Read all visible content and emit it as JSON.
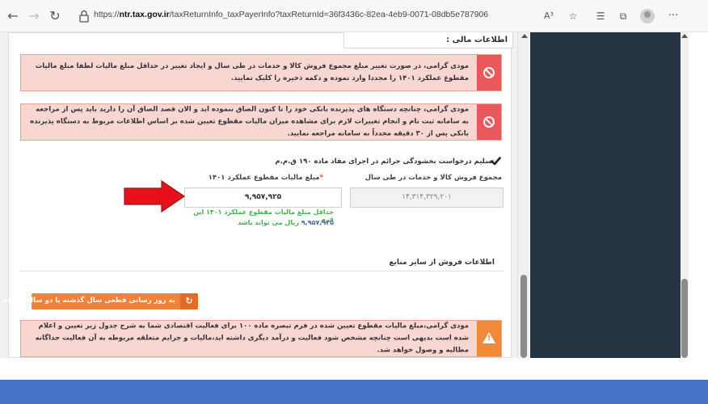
{
  "browser": {
    "url_prefix": "https://",
    "url_host": "ntr.tax.gov.ir",
    "url_path": "/taxReturnInfo_taxPayerInfo?taxReturnId=36f3436c-82ea-4eb9-0071-08db5e787906",
    "icons": [
      "back-icon",
      "forward-icon",
      "refresh-icon",
      "lock-icon",
      "read-aloud-icon",
      "favorite-icon",
      "favorites-list-icon",
      "collections-icon",
      "profile-icon",
      "more-icon"
    ],
    "read_aloud_label": "A³",
    "more_label": "···"
  },
  "panel": {
    "title": "اطلاعات مالی :"
  },
  "alerts": [
    {
      "type": "danger",
      "text": "مودی گرامی، در صورت تغییر مبلغ مجموع فروش کالا و خدمات در طی سال و ایجاد تغییر در حداقل مبلغ مالیات لطفا مبلغ مالیات مقطوع عملکرد ۱۴۰۱ را مجددا وارد نموده و دکمه ذخیره را کلیک نمایید."
    },
    {
      "type": "danger",
      "text": "مودی گرامی، چنانچه دستگاه های پذیرنده بانکی خود را تا کنون الصاق ننموده اید و الان قصد الصاق آن را دارید باید پس از مراجعه به سامانه ثبت نام و انجام تغییرات لازم برای مشاهده میزان مالیات مقطوع تعیین شده بر اساس اطلاعات مربوط به دستگاه پذیرنده بانکی پس از ۳۰ دقیقه مجدداً به سامانه مراجعه نمایید."
    }
  ],
  "checkbox": {
    "label": "تسلیم درخواست بخشودگی جرائم در اجرای مفاد ماده ۱۹۰ ق.م.م",
    "checked": true
  },
  "fields": {
    "sales_label": "مجموع فروش کالا و خدمات در طی سال",
    "sales_value": "۱۴,۳۱۴,۳۲۹,۲۰۱",
    "tax_label": "مبلغ مالیات مقطوع عملکرد ۱۴۰۱",
    "tax_required_mark": "*",
    "tax_value": "۹,۹۵۷,۹۲۵"
  },
  "hint": {
    "line1": "حداقل مبلغ مالیات مقطوع عملکرد ۱۴۰۱ این فرم",
    "amount": "۹,۹۵۷,۹۲۵",
    "line2_suffix": "ریال می تواند باشد"
  },
  "other_sales": {
    "title": "اطلاعات فروش از سایر منابع"
  },
  "update_button": {
    "label": "به روز رسانی قطعی سال گذشته یا دو سال گذشته"
  },
  "warning": {
    "type": "warning",
    "text": "مودی گرامی،مبلغ مالیات مقطوع تعیین شده در فرم تبصره ماده ۱۰۰ برای فعالیت اقتصادی شما به شرح جدول زیر تعیین و اعلام شده است بدیهی است چنانچه مشخص شود فعالیت و درآمد دیگری داشته اید،مالیات و جرایم متعلقه مربوطه به آن فعالیت جداگانه مطالبه و وصول خواهد شد."
  },
  "colors": {
    "danger_bg": "#f8d7d3",
    "danger_icon": "#e9595c",
    "warning_icon": "#f08a3a",
    "button": "#f0823c",
    "sidebar": "#273442",
    "banner": "#4472c4",
    "arrow": "#e8101a",
    "hint": "#4caf50"
  }
}
